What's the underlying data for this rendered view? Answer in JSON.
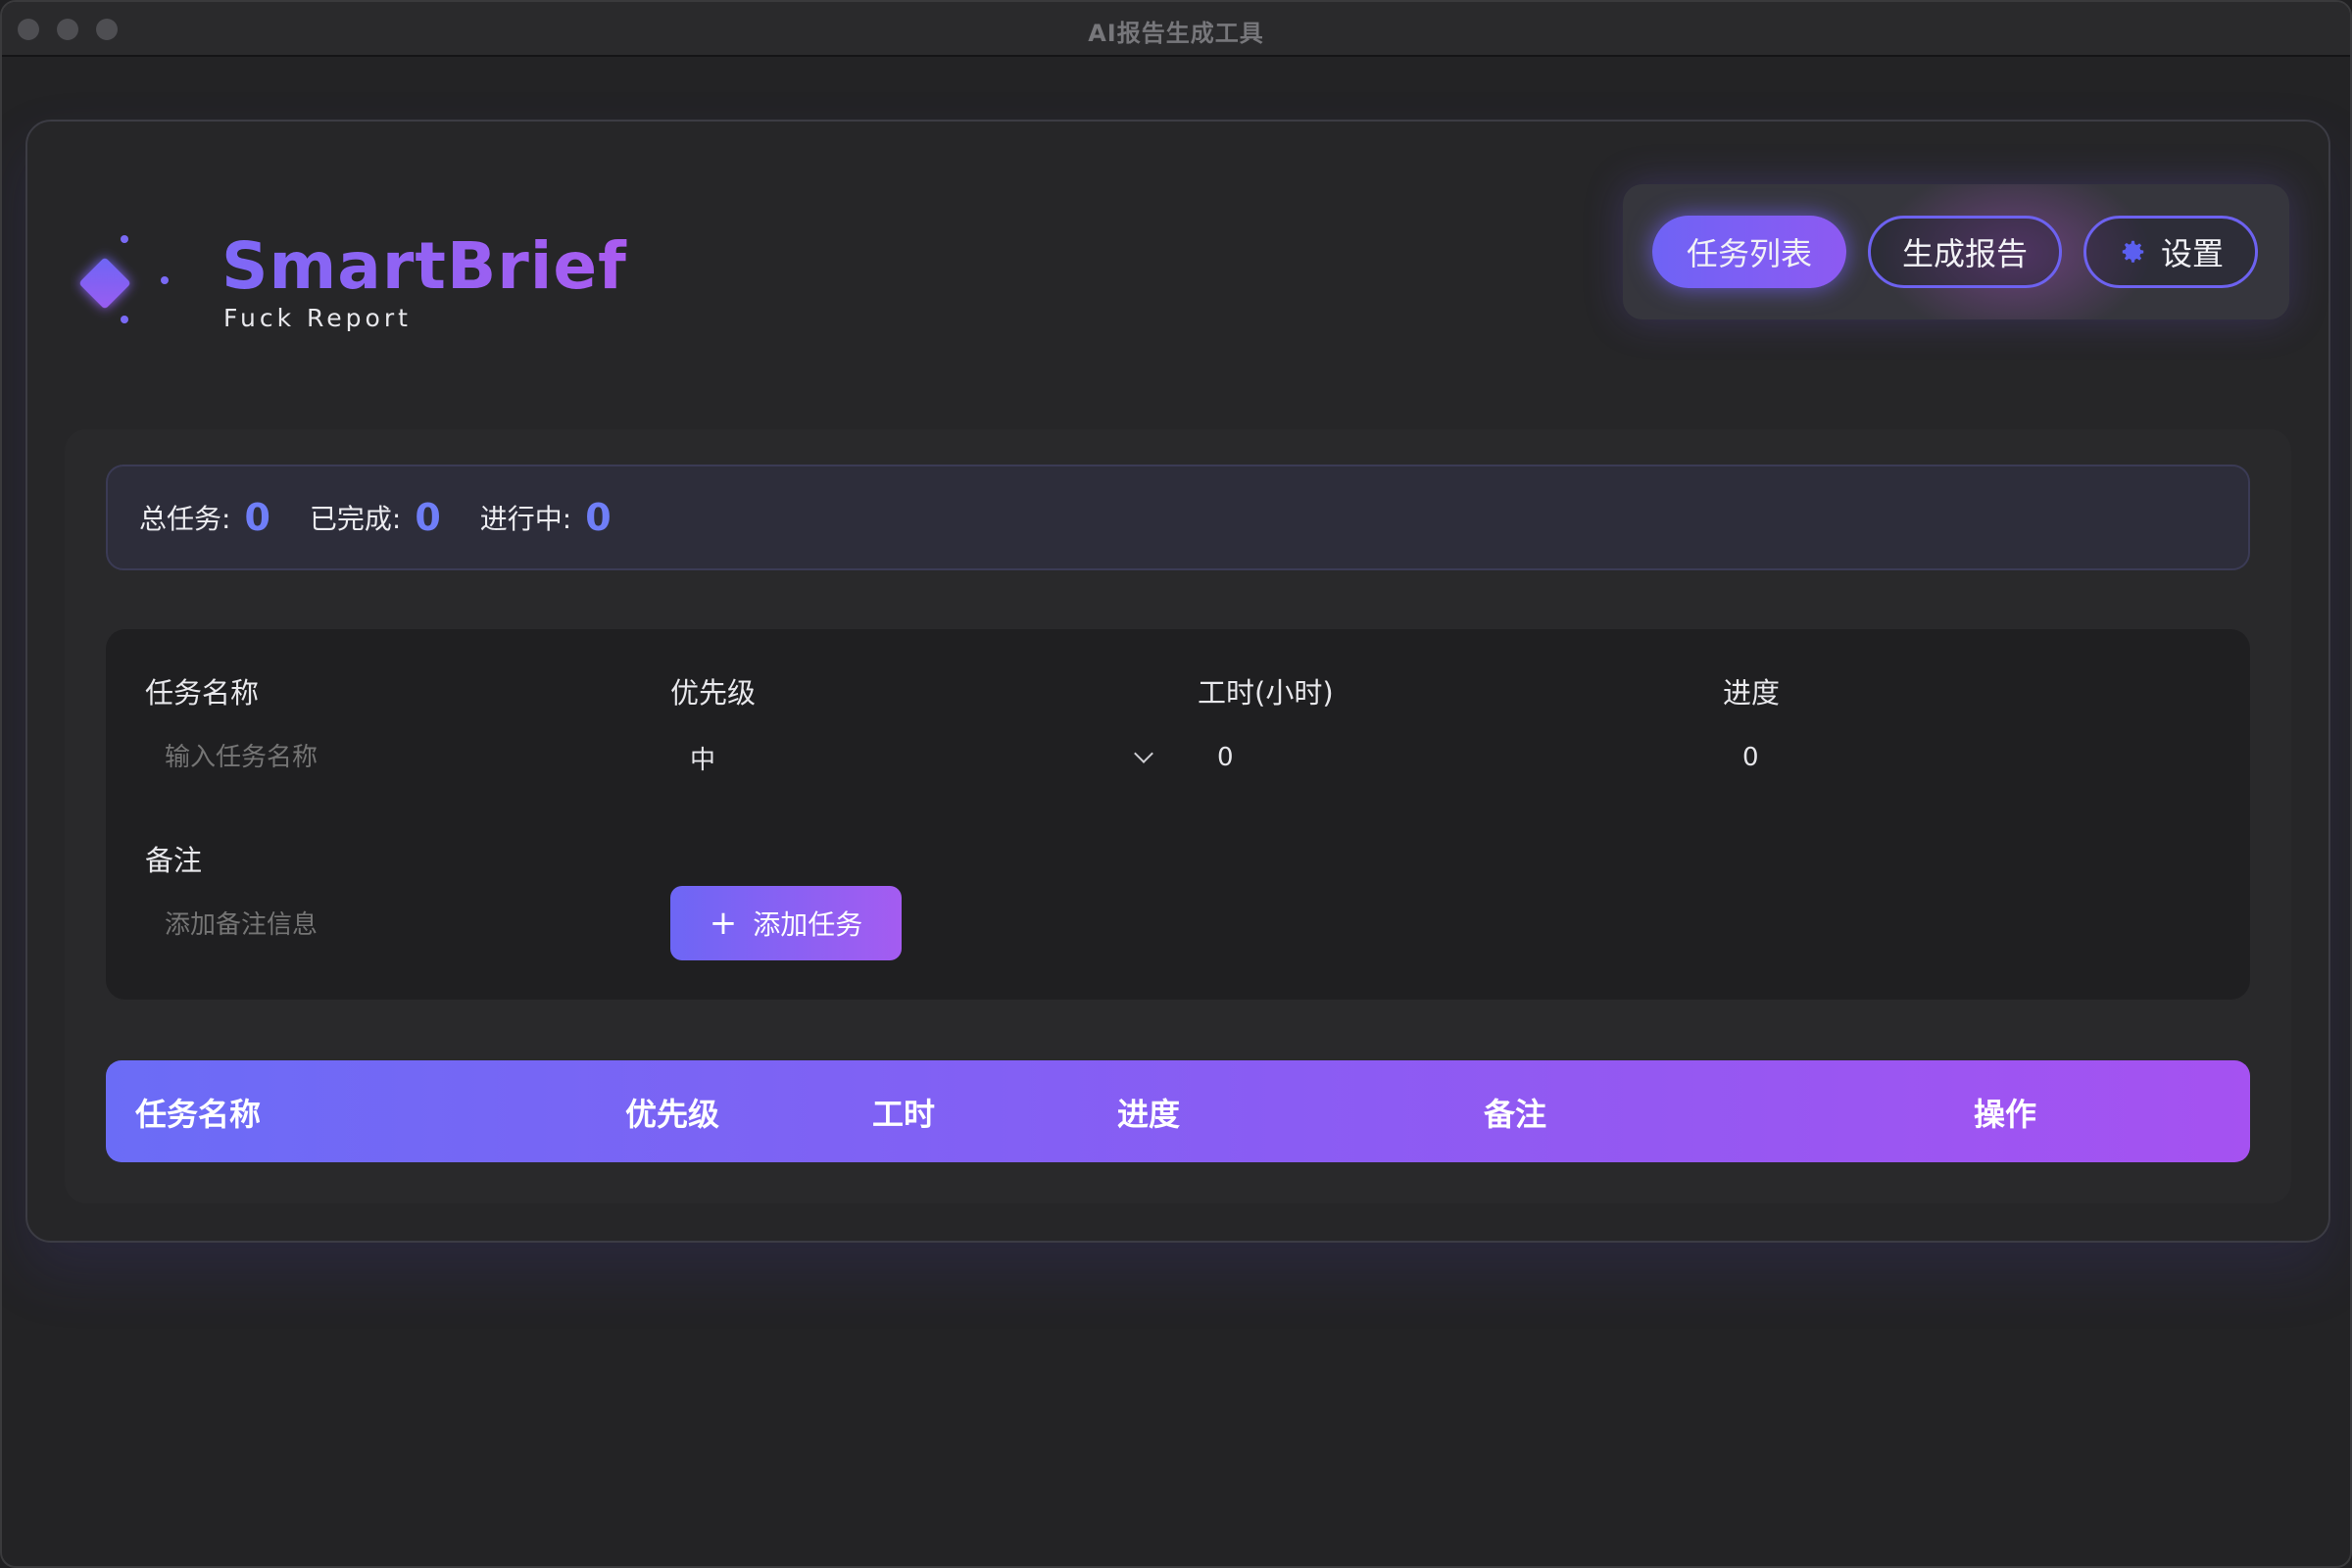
{
  "window": {
    "title": "AI报告生成工具"
  },
  "brand": {
    "name": "SmartBrief",
    "tagline": "Fuck Report"
  },
  "nav": {
    "tabs": [
      {
        "label": "任务列表",
        "active": true
      },
      {
        "label": "生成报告",
        "active": false
      },
      {
        "label": "设置",
        "active": false,
        "icon": "gear-icon"
      }
    ]
  },
  "stats": {
    "total_label": "总任务:",
    "total_value": "0",
    "done_label": "已完成:",
    "done_value": "0",
    "progress_label": "进行中:",
    "progress_value": "0"
  },
  "form": {
    "name_label": "任务名称",
    "name_placeholder": "输入任务名称",
    "priority_label": "优先级",
    "priority_value": "中",
    "hours_label": "工时(小时)",
    "hours_value": "0",
    "progress_label": "进度",
    "progress_value": "0",
    "notes_label": "备注",
    "notes_placeholder": "添加备注信息",
    "add_button": "添加任务"
  },
  "table": {
    "columns": [
      "任务名称",
      "优先级",
      "工时",
      "进度",
      "备注",
      "操作"
    ]
  },
  "colors": {
    "accent_start": "#6f63f5",
    "accent_end": "#a552f1",
    "stat_value": "#6f7ef7",
    "background": "#232325"
  }
}
